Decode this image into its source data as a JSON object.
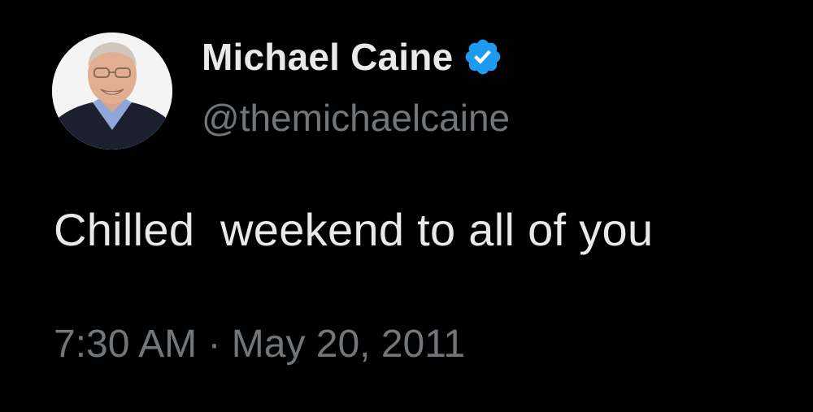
{
  "tweet": {
    "author": {
      "name": "Michael Caine",
      "handle": "@themichaelcaine",
      "verified_icon": "verified-badge-icon",
      "verified_color": "#1d9bf0"
    },
    "text": "Chilled  weekend to all of you",
    "timestamp": "7:30 AM · May 20, 2011"
  },
  "colors": {
    "background": "#000000",
    "primary_text": "#e7e9ea",
    "secondary_text": "#71767b"
  }
}
